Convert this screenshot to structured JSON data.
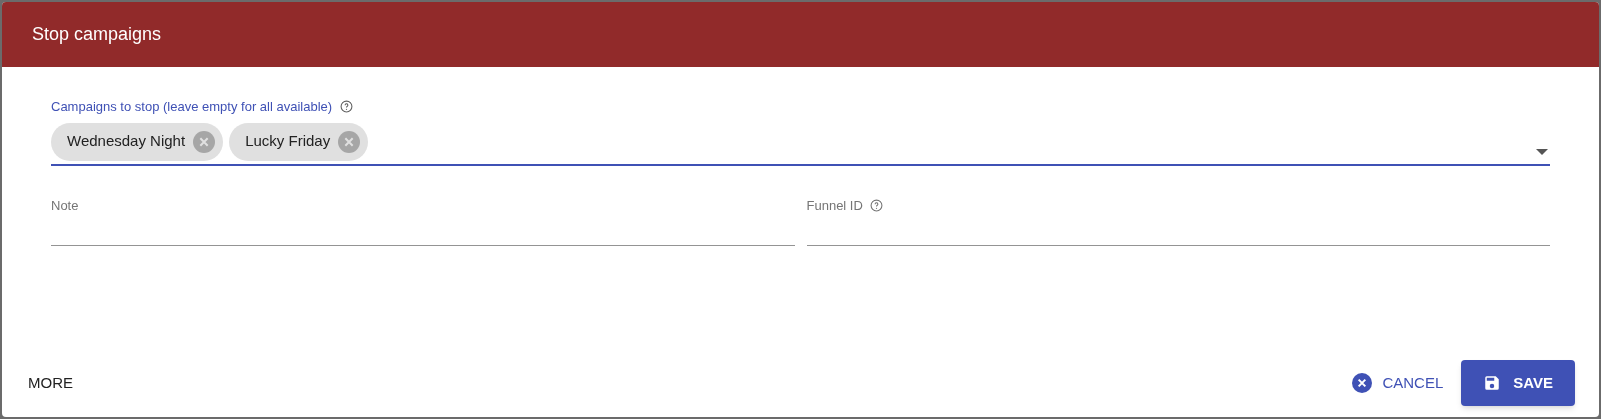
{
  "dialog": {
    "title": "Stop campaigns"
  },
  "campaigns_field": {
    "label": "Campaigns to stop (leave empty for all available)",
    "focused": true,
    "chips": [
      {
        "label": "Wednesday Night"
      },
      {
        "label": "Lucky Friday"
      }
    ]
  },
  "fields": [
    {
      "label": "Note",
      "help": false
    },
    {
      "label": "Funnel ID",
      "help": true
    }
  ],
  "footer": {
    "more": "MORE",
    "cancel": "CANCEL",
    "save": "SAVE"
  }
}
